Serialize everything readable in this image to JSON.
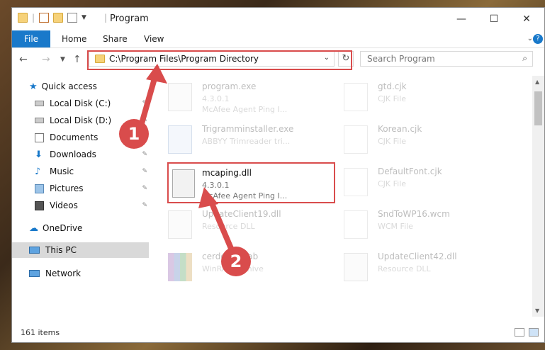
{
  "window": {
    "title": "Program"
  },
  "controls": {
    "minimize": "—",
    "maximize": "☐",
    "close": "✕"
  },
  "ribbon": {
    "tabs": [
      "File",
      "Home",
      "Share",
      "View"
    ],
    "help": "?"
  },
  "address": {
    "path": "C:\\Program Files\\Program Directory",
    "refresh": "↻"
  },
  "search": {
    "placeholder": "Search Program"
  },
  "sidebar": {
    "items": [
      {
        "label": "Quick access"
      },
      {
        "label": "Local Disk (C:)"
      },
      {
        "label": "Local Disk (D:)"
      },
      {
        "label": "Documents"
      },
      {
        "label": "Downloads"
      },
      {
        "label": "Music"
      },
      {
        "label": "Pictures"
      },
      {
        "label": "Videos"
      },
      {
        "label": "OneDrive"
      },
      {
        "label": "This PC"
      },
      {
        "label": "Network"
      }
    ]
  },
  "files": [
    {
      "name": "program.exe",
      "line2": "4.3.0.1",
      "line3": "McAfee Agent Ping I..."
    },
    {
      "name": "gtd.cjk",
      "line2": "CJK File",
      "line3": ""
    },
    {
      "name": "Trigramminstaller.exe",
      "line2": "ABBYY Trimreader tri...",
      "line3": ""
    },
    {
      "name": "Korean.cjk",
      "line2": "CJK File",
      "line3": ""
    },
    {
      "name": "mcaping.dll",
      "line2": "4.3.0.1",
      "line3": "McAfee Agent Ping I..."
    },
    {
      "name": "DefaultFont.cjk",
      "line2": "CJK File",
      "line3": ""
    },
    {
      "name": "UpdateClient19.dll",
      "line2": "Resource DLL",
      "line3": ""
    },
    {
      "name": "SndToWP16.wcm",
      "line2": "WCM File",
      "line3": ""
    },
    {
      "name": "cerdoocs.cab",
      "line2": "WinRAR archive",
      "line3": ""
    },
    {
      "name": "UpdateClient42.dll",
      "line2": "Resource DLL",
      "line3": ""
    }
  ],
  "status": {
    "count": "161 items"
  },
  "annotations": {
    "step1": "1",
    "step2": "2"
  },
  "colors": {
    "accent": "#1979ca",
    "highlight": "#d94c4c"
  }
}
